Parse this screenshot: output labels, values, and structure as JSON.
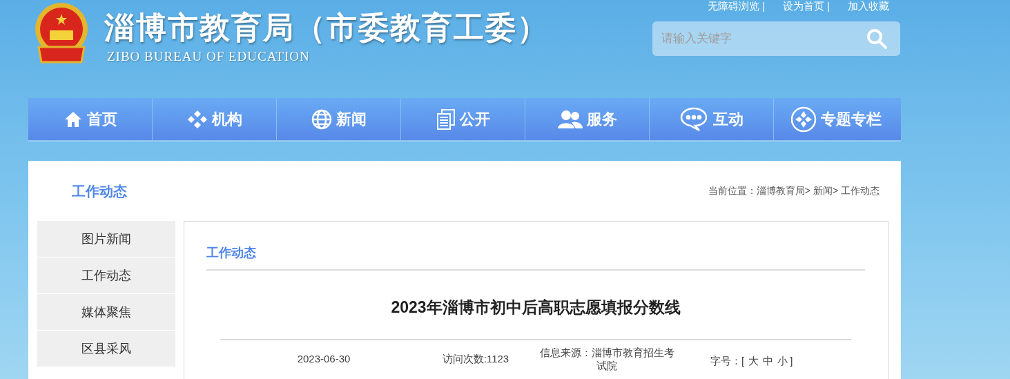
{
  "header": {
    "title": "淄博市教育局（市委教育工委）",
    "subtitle": "ZIBO BUREAU OF EDUCATION",
    "top_links": [
      {
        "label": "无障碍浏览",
        "separator": "|"
      },
      {
        "label": "设为首页",
        "separator": "|"
      },
      {
        "label": "加入收藏"
      }
    ],
    "search": {
      "placeholder": "请输入关键字"
    }
  },
  "nav": [
    {
      "label": "首页",
      "kind": "home"
    },
    {
      "label": "机构",
      "kind": "org"
    },
    {
      "label": "新闻",
      "kind": "news"
    },
    {
      "label": "公开",
      "kind": "open"
    },
    {
      "label": "服务",
      "kind": "service"
    },
    {
      "label": "互动",
      "kind": "interact"
    },
    {
      "label": "专题专栏",
      "kind": "topics"
    }
  ],
  "section_title": "工作动态",
  "breadcrumb": "当前位置：淄博教育局> 新闻> 工作动态",
  "sidebar": {
    "items": [
      {
        "label": "图片新闻",
        "selected": false
      },
      {
        "label": "工作动态",
        "selected": false
      },
      {
        "label": "媒体聚焦",
        "selected": false
      },
      {
        "label": "区县采风",
        "selected": false
      }
    ]
  },
  "article": {
    "category": "工作动态",
    "title": "2023年淄博市初中后高职志愿填报分数线",
    "date": "2023-06-30",
    "visits": "访问次数:1123",
    "source_label": "信息来源：",
    "source": "淄博市教育招生考试院",
    "font_label": "字号：",
    "font_open": "[",
    "font_sizes": [
      "大",
      "中",
      "小"
    ],
    "font_close": "]"
  }
}
